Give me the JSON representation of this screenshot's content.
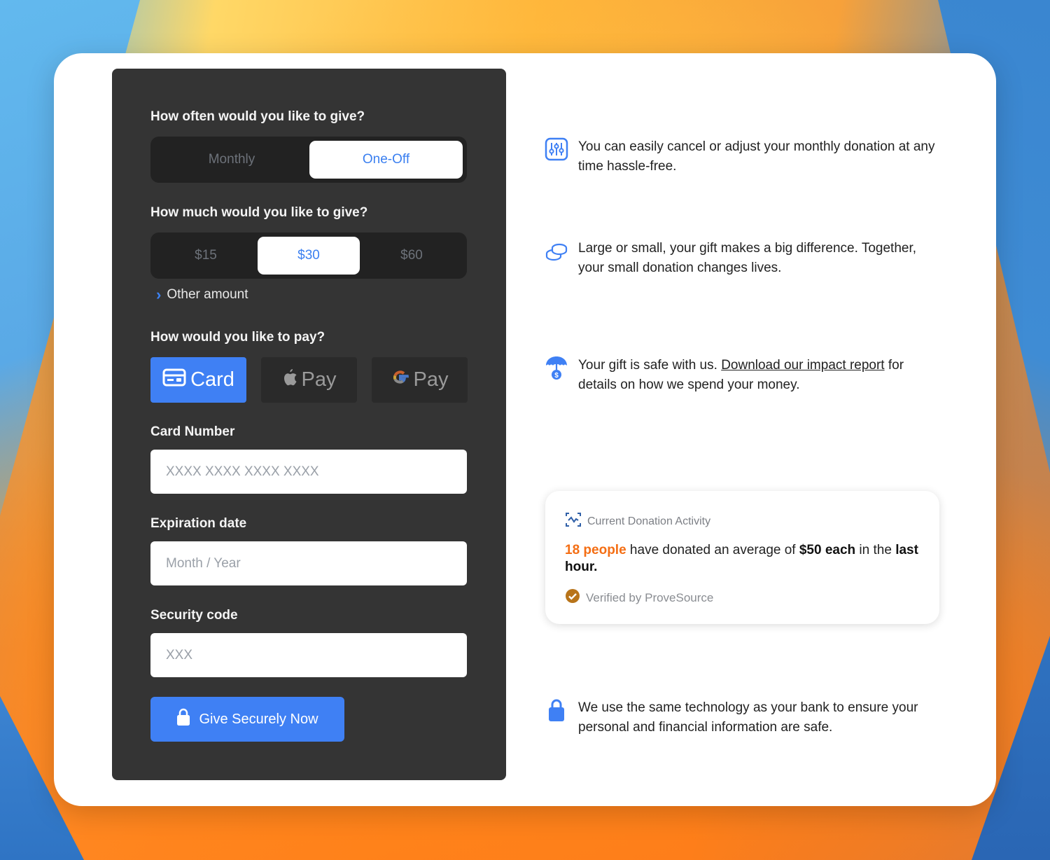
{
  "form": {
    "frequency": {
      "question": "How often would you like to give?",
      "options": [
        "Monthly",
        "One-Off"
      ],
      "selected": "One-Off"
    },
    "amount": {
      "question": "How much would you like to give?",
      "options": [
        "$15",
        "$30",
        "$60"
      ],
      "selected": "$30",
      "other_amount_label": "Other amount"
    },
    "payment": {
      "question": "How would you like to pay?",
      "methods": [
        {
          "label": "Card",
          "icon": "credit-card-icon"
        },
        {
          "label": "Pay",
          "icon": "apple-icon"
        },
        {
          "label": "Pay",
          "icon": "google-g-icon"
        }
      ],
      "selected": "Card"
    },
    "card_number": {
      "label": "Card Number",
      "placeholder": "XXXX XXXX XXXX XXXX",
      "value": ""
    },
    "expiration": {
      "label": "Expiration date",
      "placeholder": "Month / Year",
      "value": ""
    },
    "security_code": {
      "label": "Security code",
      "placeholder": "XXX",
      "value": ""
    },
    "submit_label": "Give Securely Now"
  },
  "info": {
    "items": [
      {
        "icon": "sliders-icon",
        "text": "You can easily cancel or adjust your monthly donation at any time hassle-free."
      },
      {
        "icon": "coins-icon",
        "text": "Large or small, your gift makes a big difference. Together, your small donation changes lives."
      },
      {
        "icon": "umbrella-dollar-icon",
        "text_before": "Your gift is safe with us. ",
        "link": "Download our impact report",
        "text_after": " for details on how we spend your money."
      },
      {
        "icon": "lock-icon",
        "text": "We use the same technology as your bank to ensure your personal and financial information are safe."
      }
    ]
  },
  "activity": {
    "title": "Current Donation Activity",
    "count_text": "18 people",
    "middle_text": " have donated an average of ",
    "amount_text": "$50 each",
    "after_text": " in the ",
    "period_text": "last hour.",
    "verified_text": "Verified by ProveSource"
  },
  "colors": {
    "accent": "#3f80f4",
    "panel": "#343434",
    "highlight": "#f46e14",
    "verified_badge": "#b8741a"
  }
}
